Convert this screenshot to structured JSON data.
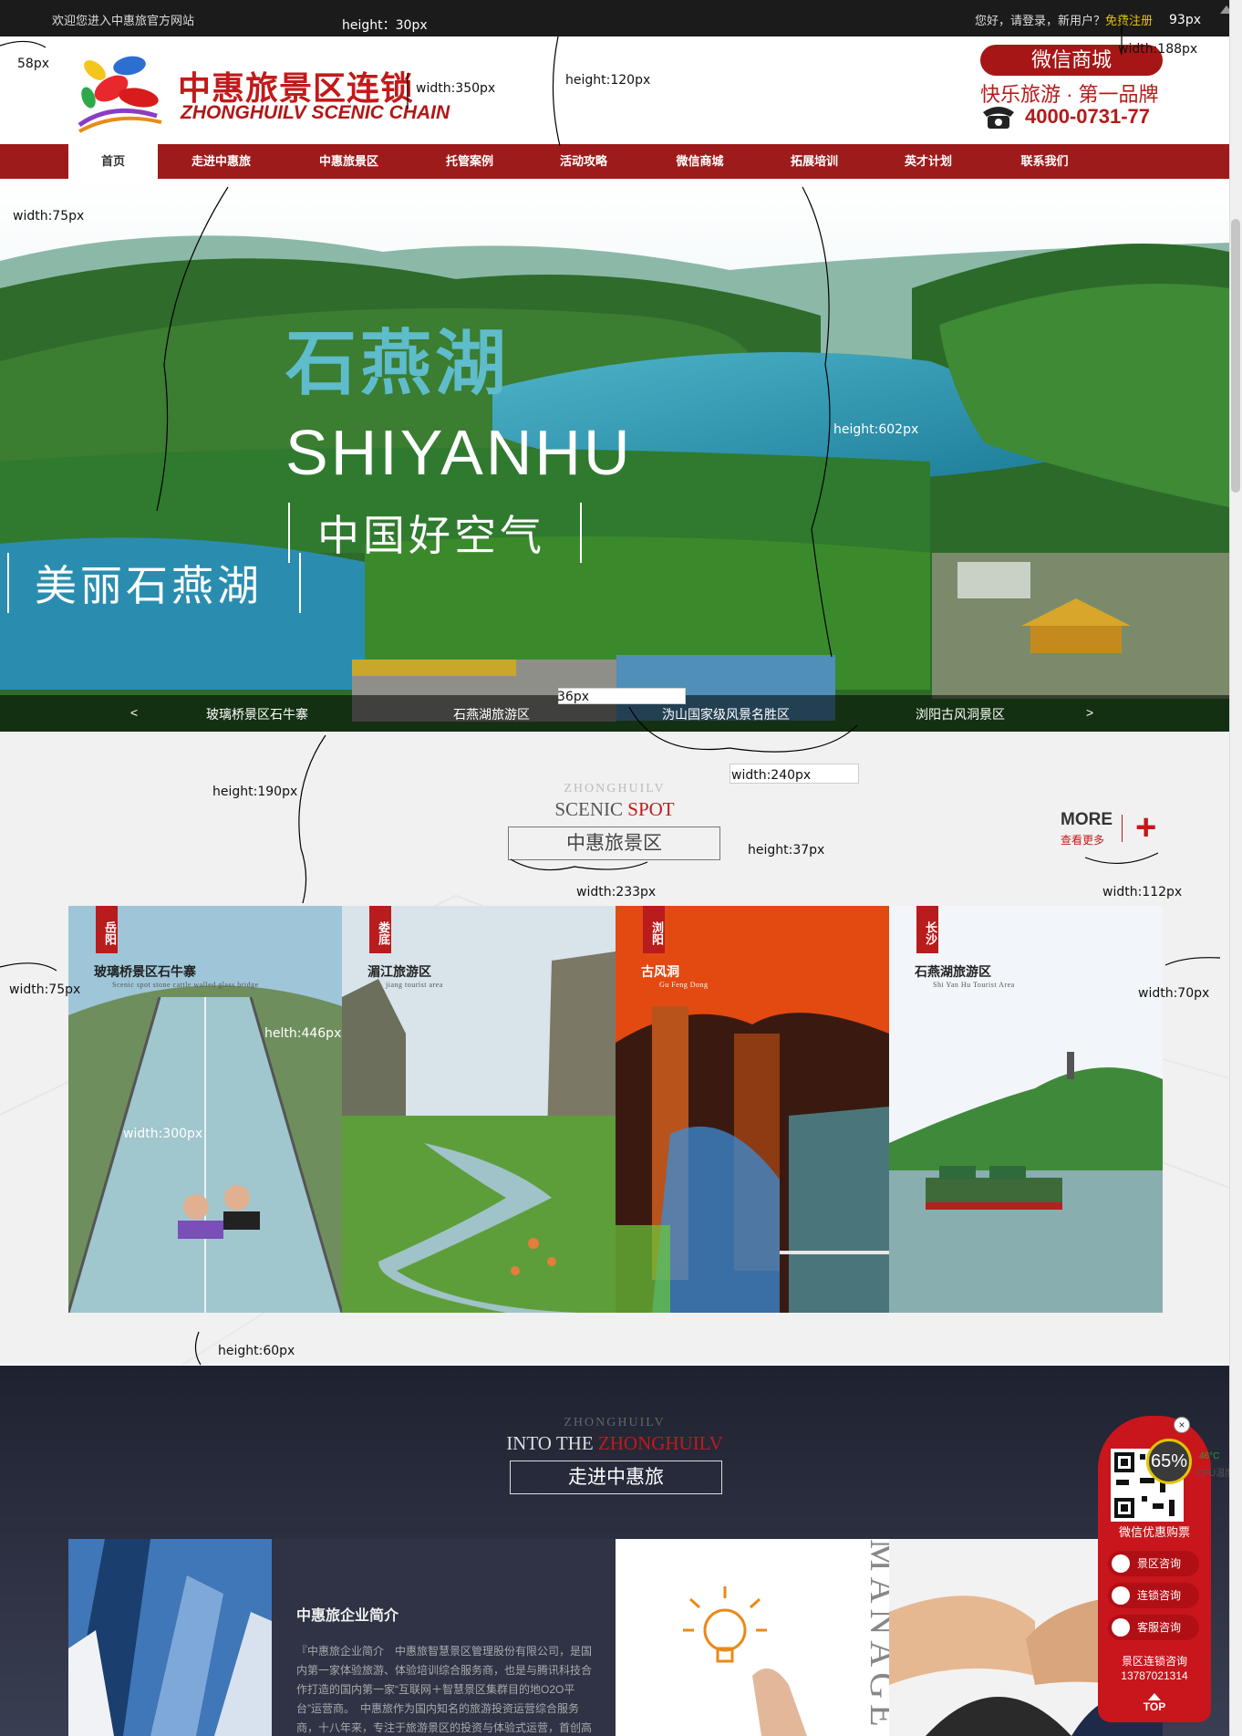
{
  "topbar": {
    "welcome": "欢迎您进入中惠旅官方网站",
    "login_prefix": "您好，请登录，新用户？",
    "register": "免费注册"
  },
  "header": {
    "brand_cn": "中惠旅景区连锁",
    "brand_en": "ZHONGHUILV SCENIC CHAIN",
    "wechat_shop": "微信商城",
    "slogan": "快乐旅游 · 第一品牌",
    "phone": "4000-0731-77"
  },
  "nav": {
    "items": [
      {
        "label": "首页"
      },
      {
        "label": "走进中惠旅"
      },
      {
        "label": "中惠旅景区"
      },
      {
        "label": "托管案例"
      },
      {
        "label": "活动攻略"
      },
      {
        "label": "微信商城"
      },
      {
        "label": "拓展培训"
      },
      {
        "label": "英才计划"
      },
      {
        "label": "联系我们"
      }
    ],
    "active_index": 0
  },
  "banner": {
    "title_cn": "石燕湖",
    "title_en": "SHIYANHU",
    "tagline": "中国好空气",
    "subtitle": "美丽石燕湖",
    "prev_arrow": "<",
    "next_arrow": ">",
    "thumbs": [
      {
        "label": "玻璃桥景区石牛寨"
      },
      {
        "label": "石燕湖旅游区"
      },
      {
        "label": "沩山国家级风景名胜区"
      },
      {
        "label": "浏阳古风洞景区"
      }
    ]
  },
  "scenic": {
    "en_small": "ZHONGHUILV",
    "en_part1": "SCENIC ",
    "en_part2": "SPOT",
    "cn": "中惠旅景区",
    "more": "MORE",
    "more_sub": "查看更多",
    "cards": [
      {
        "tag": "岳阳",
        "title": "玻璃桥景区石牛寨",
        "sub": "Scenic spot stone cattle walled glass bridge"
      },
      {
        "tag": "娄底",
        "title": "湄江旅游区",
        "sub": "jiang tourist area"
      },
      {
        "tag": "浏阳",
        "title": "古风洞",
        "sub": "Gu Feng Dong"
      },
      {
        "tag": "长沙",
        "title": "石燕湖旅游区",
        "sub": "Shi Yan Hu Tourist Area"
      }
    ]
  },
  "about": {
    "en_small": "ZHONGHUILV",
    "en_part1": "INTO THE ",
    "en_part2": "ZHONGHUILV",
    "cn": "走进中惠旅",
    "title": "中惠旅企业简介",
    "body": "『中惠旅企业简介　中惠旅智慧景区管理股份有限公司，是国内第一家体验旅游、体验培训综合服务商，也是与腾讯科技合作打造的国内第一家“互联网＋智慧景区集群目的地O2O平台”运营商。　中惠旅作为国内知名的旅游投资运营综合服务商，十八年来，专注于旅游景区的投资与体验式运营，首创高端业…",
    "side_text": "MANAGE"
  },
  "float_panel": {
    "qr_label": "微信优惠购票",
    "buttons": [
      {
        "label": "景区咨询"
      },
      {
        "label": "连锁咨询"
      },
      {
        "label": "客服咨询"
      }
    ],
    "hotline_label": "景区连锁咨询",
    "hotline": "13787021314",
    "top": "TOP",
    "close": "×"
  },
  "cpu_widget": {
    "percent": "65%",
    "temp": "46°C",
    "label": "CPU温度"
  },
  "annotations": {
    "a_top_height": "height：30px",
    "a_right_93": "93px",
    "a_logo_58": "58px",
    "a_logo_width": "width:350px",
    "a_header_height": "height:120px",
    "a_right_188": "width:188px",
    "a_nav_75": "width:75px",
    "a_banner_height": "height:602px",
    "a_thumb_36": "36px",
    "a_thumb_240": "width:240px",
    "a_sec_190": "height:190px",
    "a_sec_37": "height:37px",
    "a_sec_233": "width:233px",
    "a_more_112": "width:112px",
    "a_card_75": "width:75px",
    "a_card_70": "width:70px",
    "a_card_446": "helth:446px",
    "a_card_300": "width:300px",
    "a_bottom_60": "height:60px"
  }
}
